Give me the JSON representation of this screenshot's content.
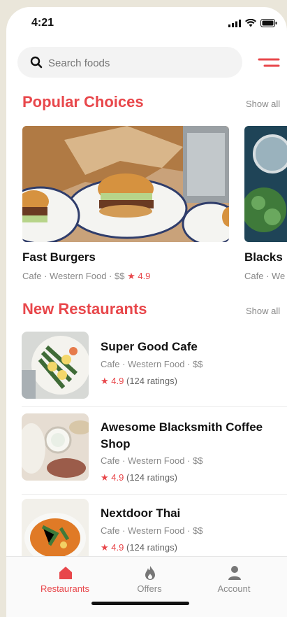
{
  "status": {
    "time": "4:21"
  },
  "search": {
    "placeholder": "Search foods"
  },
  "popular": {
    "title": "Popular Choices",
    "show_all": "Show all",
    "cards": [
      {
        "name": "Fast Burgers",
        "meta": "Cafe · Western Food · $$",
        "rating": "4.9"
      },
      {
        "name": "Blacks",
        "meta": "Cafe · We"
      }
    ]
  },
  "new_restaurants": {
    "title": "New Restaurants",
    "show_all": "Show all",
    "items": [
      {
        "name": "Super Good Cafe",
        "meta": "Cafe · Western Food · $$",
        "rating": "4.9",
        "ratings_count": "(124 ratings)"
      },
      {
        "name": "Awesome Blacksmith Coffee Shop",
        "meta": "Cafe · Western Food · $$",
        "rating": "4.9",
        "ratings_count": "(124 ratings)"
      },
      {
        "name": "Nextdoor Thai",
        "meta": "Cafe · Western Food · $$",
        "rating": "4.9",
        "ratings_count": "(124 ratings)"
      }
    ]
  },
  "tabbar": {
    "tabs": [
      {
        "label": "Restaurants",
        "icon": "restaurant-icon",
        "active": true
      },
      {
        "label": "Offers",
        "icon": "flame-icon",
        "active": false
      },
      {
        "label": "Account",
        "icon": "user-icon",
        "active": false
      }
    ]
  },
  "colors": {
    "accent": "#e8474b",
    "muted": "#888888"
  }
}
